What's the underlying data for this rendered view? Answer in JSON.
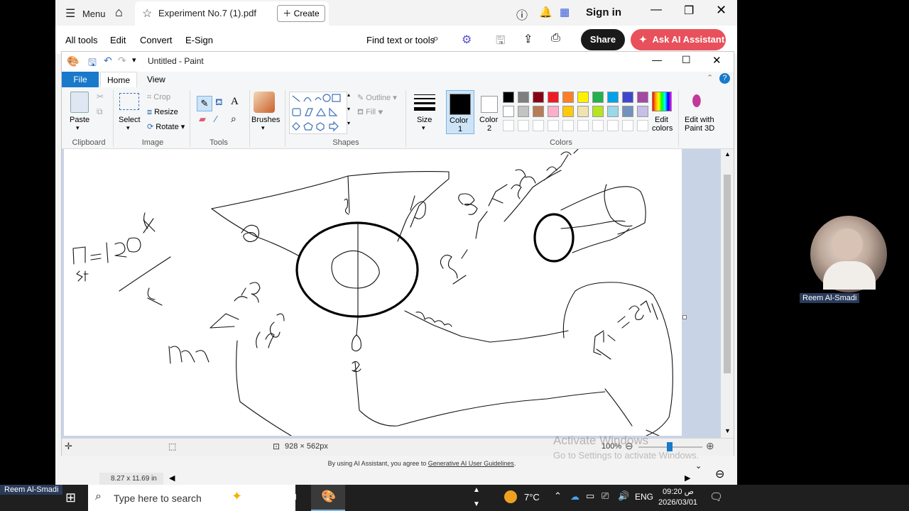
{
  "acrobat": {
    "menu": "Menu",
    "tab_title": "Experiment No.7 (1).pdf",
    "create": "Create",
    "sign_in": "Sign in",
    "menus": [
      "All tools",
      "Edit",
      "Convert",
      "E-Sign"
    ],
    "find": "Find text or tools",
    "share": "Share",
    "ask_ai": "Ask AI Assistant",
    "page_size": "8.27 x 11.69 in",
    "footer_prefix": "By using AI Assistant, you agree to ",
    "footer_link": "Generative AI User Guidelines",
    "footer_suffix": "."
  },
  "paint": {
    "title": "Untitled - Paint",
    "tabs": [
      "File",
      "Home",
      "View"
    ],
    "clipboard": {
      "paste": "Paste",
      "label": "Clipboard"
    },
    "image": {
      "select": "Select",
      "crop": "Crop",
      "resize": "Resize",
      "rotate": "Rotate",
      "label": "Image"
    },
    "tools": {
      "label": "Tools"
    },
    "brushes": "Brushes",
    "shapes": {
      "outline": "Outline",
      "fill": "Fill",
      "label": "Shapes"
    },
    "size": "Size",
    "color1": "Color\n1",
    "color1_a": "Color",
    "color1_b": "1",
    "color2_a": "Color",
    "color2_b": "2",
    "colors_label": "Colors",
    "edit_colors_a": "Edit",
    "edit_colors_b": "colors",
    "paint3d_a": "Edit with",
    "paint3d_b": "Paint 3D",
    "palette_row1": [
      "#000000",
      "#7f7f7f",
      "#880015",
      "#ed1c24",
      "#ff7f27",
      "#fff200",
      "#22b14c",
      "#00a2e8",
      "#3f48cc",
      "#a349a4"
    ],
    "palette_row2": [
      "#ffffff",
      "#c3c3c3",
      "#b97a57",
      "#ffaec9",
      "#ffc90e",
      "#efe4b0",
      "#b5e61d",
      "#99d9ea",
      "#7092be",
      "#c8bfe7"
    ],
    "canvas_size": "928 × 562px",
    "zoom": "100%"
  },
  "watermark": {
    "line1": "Activate Windows",
    "line2": "Go to Settings to activate Windows."
  },
  "participant": "Reem Al-Smadi",
  "taskbar": {
    "presenter": "Reem Al-Smadi",
    "search": "Type here to search",
    "temp": "7°C",
    "lang": "ENG",
    "time": "09:20 ص",
    "date": "2026/03/01"
  }
}
